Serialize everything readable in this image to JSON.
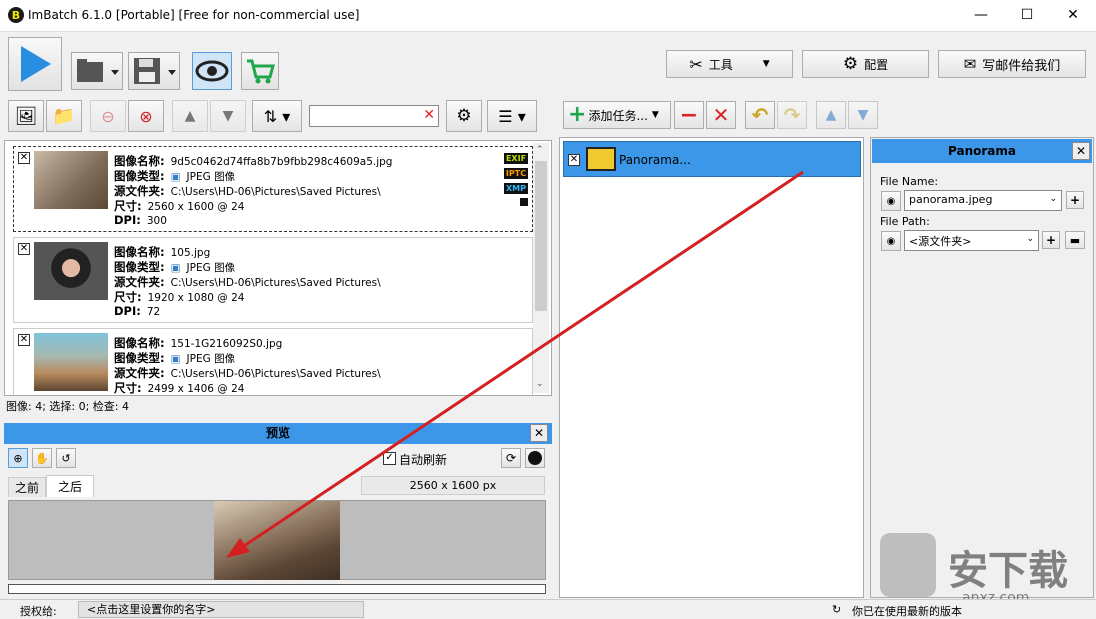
{
  "window": {
    "title": "ImBatch 6.1.0 [Portable] [Free for non-commercial use]",
    "min": "—",
    "max": "☐",
    "close": "✕"
  },
  "toolbar": {
    "tools_label": "工具",
    "config_label": "配置",
    "email_label": "写邮件给我们"
  },
  "left_toolbar": {
    "search_placeholder": "",
    "search_clear": "✕"
  },
  "images": [
    {
      "name_label": "图像名称:",
      "name": "9d5c0462d74ffa8b7b9fbb298c4609a5.jpg",
      "type_label": "图像类型:",
      "type": "JPEG 图像",
      "folder_label": "源文件夹:",
      "folder": "C:\\Users\\HD-06\\Pictures\\Saved Pictures\\",
      "size_label": "尺寸:",
      "size": "2560 x 1600 @ 24",
      "dpi_label": "DPI:",
      "dpi": "300",
      "badges": [
        "EXIF",
        "IPTC",
        "XMP"
      ]
    },
    {
      "name_label": "图像名称:",
      "name": "105.jpg",
      "type_label": "图像类型:",
      "type": "JPEG 图像",
      "folder_label": "源文件夹:",
      "folder": "C:\\Users\\HD-06\\Pictures\\Saved Pictures\\",
      "size_label": "尺寸:",
      "size": "1920 x 1080 @ 24",
      "dpi_label": "DPI:",
      "dpi": "72"
    },
    {
      "name_label": "图像名称:",
      "name": "151-1G216092S0.jpg",
      "type_label": "图像类型:",
      "type": "JPEG 图像",
      "folder_label": "源文件夹:",
      "folder": "C:\\Users\\HD-06\\Pictures\\Saved Pictures\\",
      "size_label": "尺寸:",
      "size": "2499 x 1406 @ 24"
    }
  ],
  "image_status": "图像: 4; 选择: 0; 检查: 4",
  "preview": {
    "title": "预览",
    "auto_refresh": "自动刷新",
    "tab_before": "之前",
    "tab_after": "之后",
    "dimensions": "2560 x 1600 px"
  },
  "tasks": {
    "add_label": "添加任务...",
    "items": [
      {
        "label": "Panorama..."
      }
    ]
  },
  "right_panel": {
    "title": "Panorama",
    "file_name_label": "File Name:",
    "file_name_value": "panorama.jpeg",
    "file_path_label": "File Path:",
    "file_path_value": "<源文件夹>"
  },
  "statusbar": {
    "license_label": "授权给:",
    "license_value": "<点击这里设置你的名字>",
    "version_text": "你已在使用最新的版本"
  },
  "watermark": {
    "text": "安下载",
    "sub": "anxz.com"
  }
}
